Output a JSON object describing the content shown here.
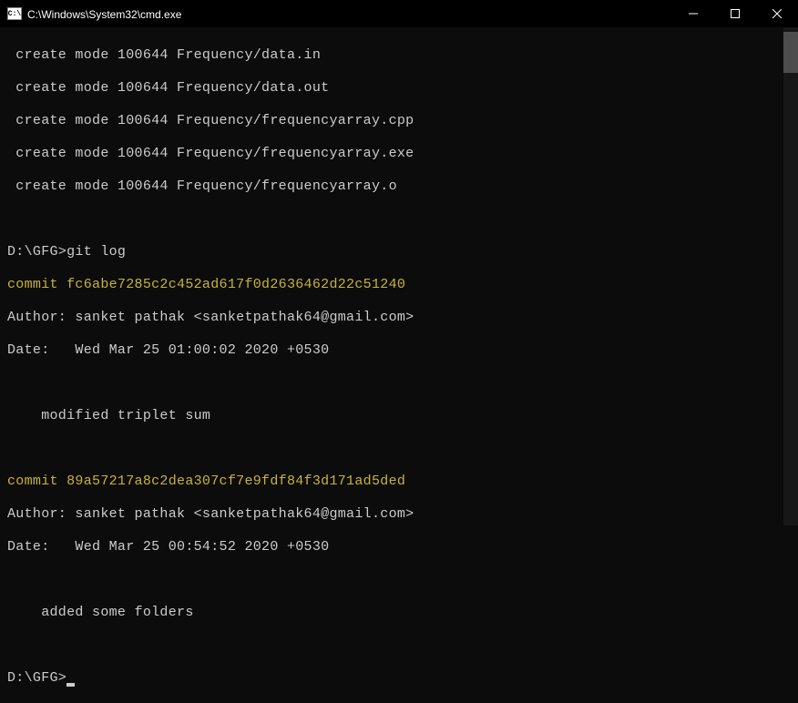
{
  "window": {
    "icon_text": "C:\\",
    "title": "C:\\Windows\\System32\\cmd.exe"
  },
  "terminal": {
    "create_lines": [
      " create mode 100644 Frequency/data.in",
      " create mode 100644 Frequency/data.out",
      " create mode 100644 Frequency/frequencyarray.cpp",
      " create mode 100644 Frequency/frequencyarray.exe",
      " create mode 100644 Frequency/frequencyarray.o"
    ],
    "prompt1_path": "D:\\GFG>",
    "prompt1_cmd": "git log",
    "commits": [
      {
        "commit_line": "commit fc6abe7285c2c452ad617f0d2636462d22c51240",
        "author_line": "Author: sanket pathak <sanketpathak64@gmail.com>",
        "date_line": "Date:   Wed Mar 25 01:00:02 2020 +0530",
        "message": "    modified triplet sum"
      },
      {
        "commit_line": "commit 89a57217a8c2dea307cf7e9fdf84f3d171ad5ded",
        "author_line": "Author: sanket pathak <sanketpathak64@gmail.com>",
        "date_line": "Date:   Wed Mar 25 00:54:52 2020 +0530",
        "message": "    added some folders"
      }
    ],
    "prompt2_path": "D:\\GFG>"
  }
}
